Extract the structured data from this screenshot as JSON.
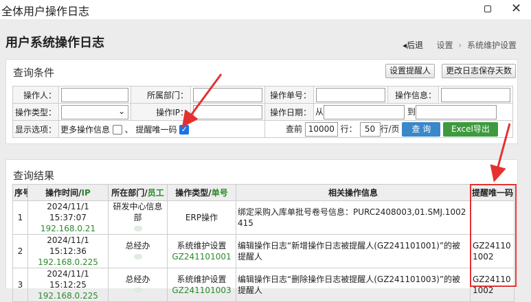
{
  "window": {
    "title": "全体用户操作日志"
  },
  "page": {
    "title": "用户系统操作日志",
    "breadcrumb": {
      "back": "后退",
      "items": [
        "设置",
        "系统维护设置"
      ]
    }
  },
  "query": {
    "heading": "查询条件",
    "buttons": {
      "set_reminder": "设置提醒人",
      "change_days": "更改日志保存天数"
    },
    "labels": {
      "operator": "操作人：",
      "dept": "所属部门：",
      "op_no": "操作单号：",
      "op_info": "操作信息：",
      "op_type": "操作类型：",
      "op_ip": "操作IP：",
      "op_date": "操作日期：",
      "from": "从",
      "to": "到",
      "display": "显示选项：",
      "more_info": "更多操作信息",
      "sep": "、",
      "remind_code": "提醒唯一码",
      "query_prefix": "查前",
      "rows_suffix": "行：",
      "per_page_suffix": "行/页"
    },
    "values": {
      "query_rows": "10000",
      "per_page": "50"
    },
    "actions": {
      "search": "查 询",
      "excel": "Excel导出"
    }
  },
  "results": {
    "heading": "查询结果",
    "headers": {
      "no": "序号",
      "time": "操作时间/",
      "ip": "IP",
      "dept": "所在部门/",
      "staff": "员工",
      "type": "操作类型/",
      "doc": "单号",
      "info": "相关操作信息",
      "code": "提醒唯一码"
    },
    "rows": [
      {
        "no": "1",
        "time": "2024/11/1 15:37:07",
        "ip": "192.168.0.21",
        "dept": "研发中心信息部",
        "type": "ERP操作",
        "doc": "",
        "info": "绑定采购入库单批号卷号信息：PURC2408003,01.SMJ.1002415",
        "code": ""
      },
      {
        "no": "2",
        "time": "2024/11/1 15:12:36",
        "ip": "192.168.0.225",
        "dept": "总经办",
        "type": "系统维护设置",
        "doc": "GZ241101001",
        "info": "编辑操作日志“新增操作日志被提醒人(GZ241101001)”的被提醒人",
        "code": "GZ241101002"
      },
      {
        "no": "3",
        "time": "2024/11/1 15:12:25",
        "ip": "192.168.0.225",
        "dept": "总经办",
        "type": "系统维护设置",
        "doc": "GZ241101003",
        "info": "编辑操作日志“删除操作日志被提醒人(GZ241101003)”的被提醒人",
        "code": "GZ241101002"
      }
    ]
  },
  "colors": {
    "accent_blue": "#3a87c9",
    "excel_green": "#3e9a3e",
    "highlight_red": "#e53030",
    "link_green": "#2a8a2a"
  }
}
